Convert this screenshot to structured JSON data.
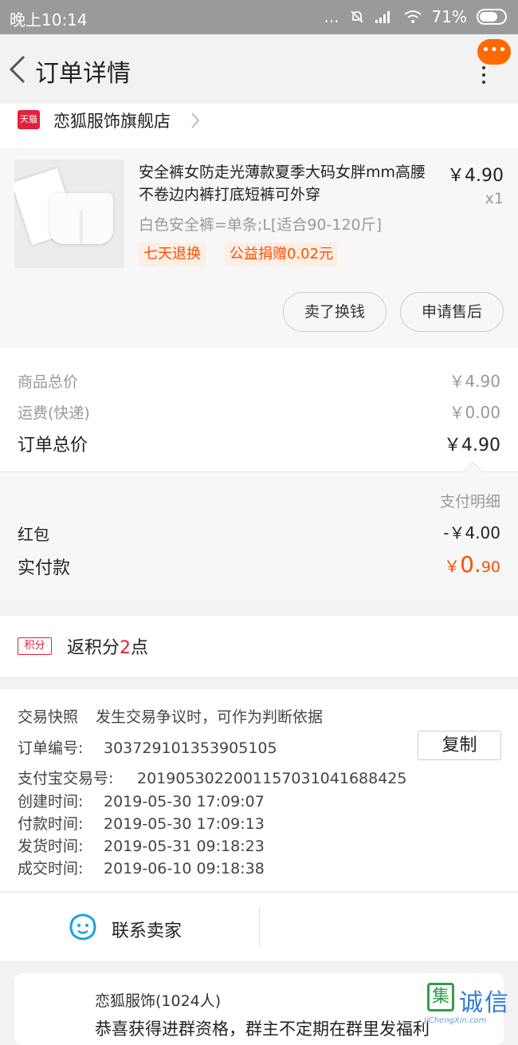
{
  "status_bar": {
    "time": "晚上10:14",
    "dots": "...",
    "battery": "71%"
  },
  "nav": {
    "title": "订单详情",
    "more": "•••"
  },
  "store": {
    "badge": "天猫",
    "name": "恋狐服饰旗舰店"
  },
  "product": {
    "title": "安全裤女防走光薄款夏季大码女胖mm高腰不卷边内裤打底短裤可外穿",
    "price": "￥4.90",
    "qty": "x1",
    "spec": "白色安全裤=单条;L[适合90-120斤]",
    "tags": [
      "七天退换",
      "公益捐赠0.02元"
    ],
    "buttons": {
      "sell": "卖了换钱",
      "after_sale": "申请售后"
    }
  },
  "prices": {
    "goods_label": "商品总价",
    "goods_value": "￥4.90",
    "shipping_label": "运费(快递)",
    "shipping_value": "￥0.00",
    "total_label": "订单总价",
    "total_value": "￥4.90"
  },
  "payment": {
    "detail": "支付明细",
    "redpacket_label": "红包",
    "redpacket_value": "-￥4.00",
    "paid_label": "实付款",
    "paid_currency": "￥",
    "paid_int": "0.",
    "paid_dec": "90"
  },
  "points": {
    "badge": "积分",
    "prefix": "返积分",
    "num": "2",
    "suffix": "点"
  },
  "order_info": {
    "snapshot_label": "交易快照",
    "snapshot_text": "发生交易争议时，可作为判断依据",
    "order_no_label": "订单编号:",
    "order_no": "303729101353905105",
    "copy": "复制",
    "alipay_label": "支付宝交易号:",
    "alipay_no": "2019053022001157031041688425",
    "created_label": "创建时间:",
    "created": "2019-05-30 17:09:07",
    "paid_label": "付款时间:",
    "paid": "2019-05-30 17:09:13",
    "shipped_label": "发货时间:",
    "shipped": "2019-05-31 09:18:23",
    "done_label": "成交时间:",
    "done": "2019-06-10 09:18:38"
  },
  "contact": {
    "label": "联系卖家"
  },
  "group": {
    "name": "恋狐服饰(1024人)",
    "message": "恭喜获得进群资格，群主不定期在群里发福利"
  },
  "watermark": {
    "box": "集",
    "cn": "诚信",
    "en": "JiChengXin.com"
  },
  "colors": {
    "accent": "#ff5000",
    "tmall": "#e5203a",
    "more_button": "#ff6a00"
  }
}
